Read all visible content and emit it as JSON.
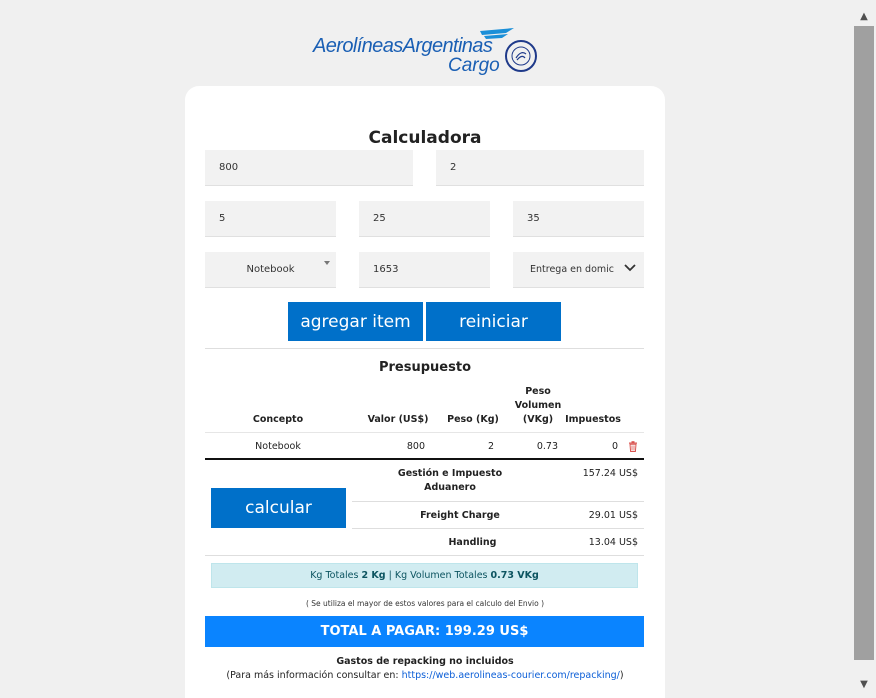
{
  "logo": {
    "brand": "AerolíneasArgentinas",
    "sub": "Cargo",
    "seal": "SKYTEAM CARGO"
  },
  "calculator": {
    "title": "Calculadora",
    "value_usd": "800",
    "weight_kg": "2",
    "length": "5",
    "width": "25",
    "height": "35",
    "concept": "Notebook",
    "postal_code": "1653",
    "delivery": "Entrega en domic",
    "add_label": "agregar item",
    "reset_label": "reiniciar"
  },
  "budget": {
    "title": "Presupuesto",
    "headers": {
      "concept": "Concepto",
      "value": "Valor (US$)",
      "weight": "Peso (Kg)",
      "vol_weight": [
        "Peso",
        "Volumen",
        "(VKg)"
      ],
      "taxes": "Impuestos"
    },
    "rows": [
      {
        "concept": "Notebook",
        "value": "800",
        "weight": "2",
        "vol_weight": "0.73",
        "taxes": "0"
      }
    ],
    "calculate_label": "calcular",
    "charges": [
      {
        "label": "Gestión e Impuesto Aduanero",
        "amount": "157.24 US$"
      },
      {
        "label": "Freight Charge",
        "amount": "29.01 US$"
      },
      {
        "label": "Handling",
        "amount": "13.04 US$"
      }
    ],
    "totals": {
      "kg_label": "Kg Totales",
      "kg_value": "2 Kg",
      "sep": "|",
      "vkg_label": "Kg Volumen Totales",
      "vkg_value": "0.73 VKg"
    },
    "note": "( Se utiliza el mayor de estos valores para el calculo del Envio )",
    "total_label": "TOTAL A PAGAR: 199.29 US$",
    "repacking_bold": "Gastos de repacking no incluidos",
    "repacking_prefix": "(Para más información consultar en: ",
    "repacking_link": "https://web.aerolineas-courier.com/repacking/",
    "repacking_suffix": ")"
  },
  "colors": {
    "button": "#0070c9",
    "total_bar": "#0a84ff",
    "info_bg": "#d1ecf1",
    "delete": "#d9534f"
  },
  "icons": {
    "delete": "trash-icon",
    "dropdown": "chevron-down-icon"
  }
}
